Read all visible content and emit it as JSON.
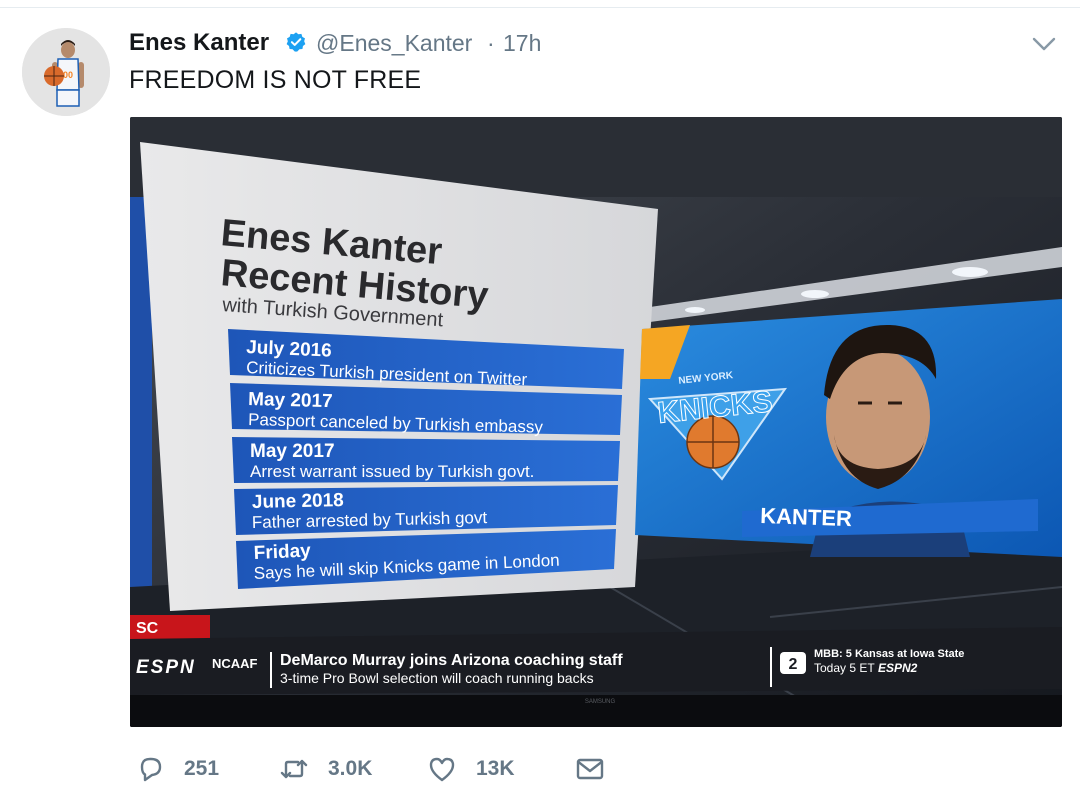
{
  "tweet": {
    "author_name": "Enes Kanter",
    "handle": "@Enes_Kanter",
    "separator": "·",
    "timestamp": "17h",
    "text": "FREEDOM IS NOT FREE",
    "verified": true
  },
  "media": {
    "graphic_title_line1": "Enes Kanter",
    "graphic_title_line2": "Recent History",
    "graphic_subtitle": "with Turkish Government",
    "timeline": [
      {
        "date": "July 2016",
        "event": "Criticizes Turkish president on Twitter"
      },
      {
        "date": "May 2017",
        "event": "Passport canceled by Turkish embassy"
      },
      {
        "date": "May 2017",
        "event": "Arrest warrant issued by Turkish govt."
      },
      {
        "date": "June 2018",
        "event": "Father arrested by Turkish govt"
      },
      {
        "date": "Friday",
        "event": "Says he will skip Knicks game in London"
      }
    ],
    "player_label": "KANTER",
    "team_logo_text_top": "NEW YORK",
    "team_logo_text": "KNICKS",
    "show_bug": "SC",
    "network": "ESPN",
    "ticker_category": "NCAAF",
    "ticker_headline": "DeMarco Murray joins Arizona coaching staff",
    "ticker_subline": "3-time Pro Bowl selection will coach running backs",
    "promo_line1": "MBB: 5 Kansas at Iowa State",
    "promo_line2": "Today 5 ET",
    "promo_network": "ESPN2",
    "promo_badge": "2",
    "tv_brand": "SAMSUNG"
  },
  "actions": {
    "reply_count": "251",
    "retweet_count": "3.0K",
    "like_count": "13K"
  },
  "icons": {
    "reply": "reply-icon",
    "retweet": "retweet-icon",
    "like": "heart-icon",
    "dm": "envelope-icon",
    "verified": "verified-badge-icon",
    "menu": "chevron-down-icon"
  },
  "colors": {
    "verified_blue": "#1da1f2",
    "meta_gray": "#657786",
    "knicks_blue": "#1d5fb4",
    "knicks_orange": "#f58426",
    "espn_red": "#d41a1f"
  }
}
